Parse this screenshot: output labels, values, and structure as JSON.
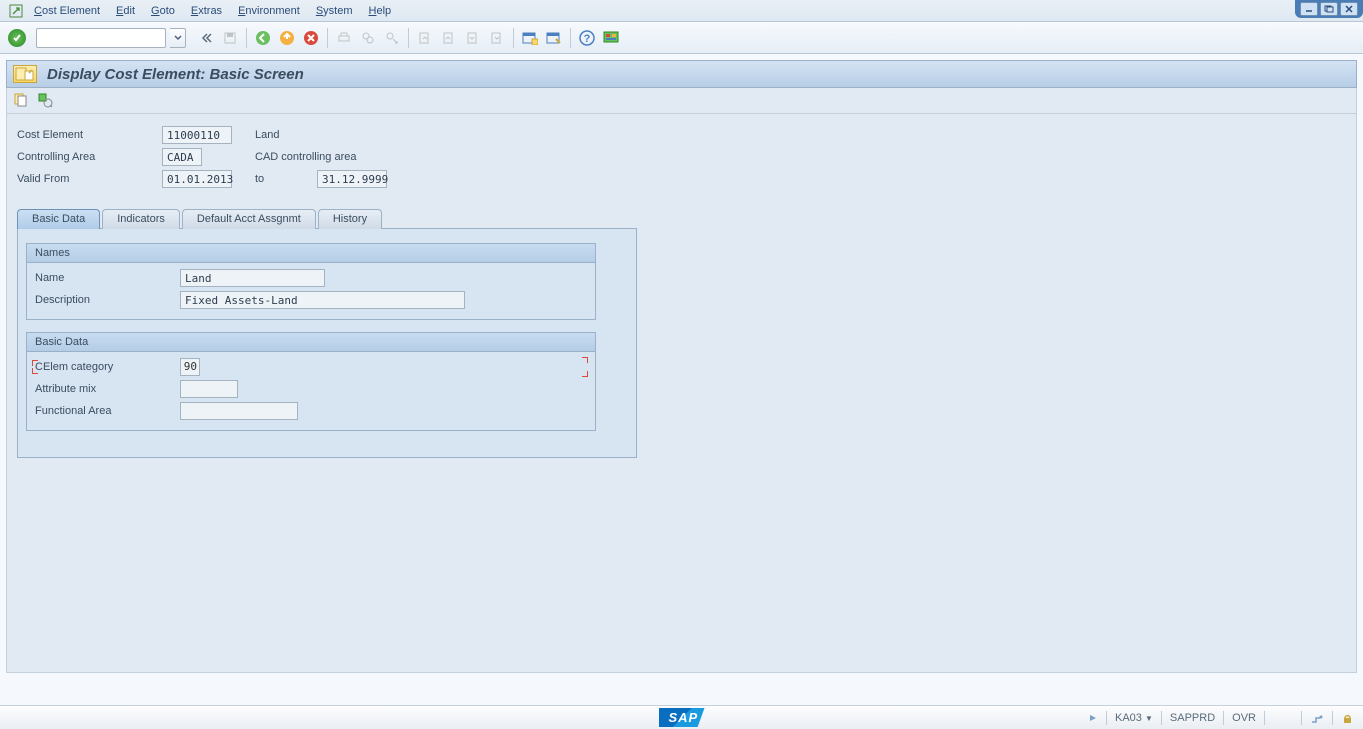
{
  "menu": {
    "items": [
      "Cost Element",
      "Edit",
      "Goto",
      "Extras",
      "Environment",
      "System",
      "Help"
    ]
  },
  "page_title": "Display Cost Element: Basic Screen",
  "header": {
    "cost_element_label": "Cost Element",
    "cost_element_value": "11000110",
    "cost_element_text": "Land",
    "controlling_area_label": "Controlling Area",
    "controlling_area_value": "CADA",
    "controlling_area_text": "CAD controlling area",
    "valid_from_label": "Valid From",
    "valid_from_value": "01.01.2013",
    "to_label": "to",
    "to_value": "31.12.9999"
  },
  "tabs": [
    "Basic Data",
    "Indicators",
    "Default Acct Assgnmt",
    "History"
  ],
  "group_names": {
    "title": "Names",
    "name_label": "Name",
    "name_value": "Land",
    "description_label": "Description",
    "description_value": "Fixed Assets-Land"
  },
  "group_basic": {
    "title": "Basic Data",
    "celem_category_label": "CElem category",
    "celem_category_value": "90",
    "attribute_mix_label": "Attribute mix",
    "attribute_mix_value": "",
    "functional_area_label": "Functional Area",
    "functional_area_value": ""
  },
  "statusbar": {
    "tcode": "KA03",
    "system": "SAPPRD",
    "mode": "OVR"
  }
}
